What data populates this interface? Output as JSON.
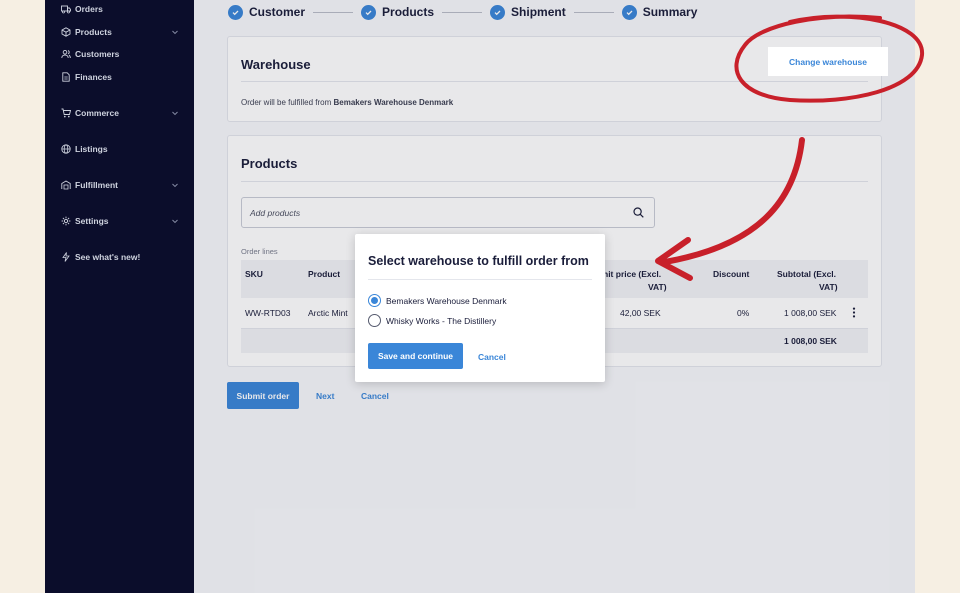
{
  "sidebar": {
    "items": [
      {
        "label": "Orders",
        "icon": "truck-icon",
        "has_chevron": false
      },
      {
        "label": "Products",
        "icon": "box-icon",
        "has_chevron": true
      },
      {
        "label": "Customers",
        "icon": "users-icon",
        "has_chevron": false
      },
      {
        "label": "Finances",
        "icon": "document-icon",
        "has_chevron": false
      },
      {
        "label": "Commerce",
        "icon": "cart-icon",
        "has_chevron": true
      },
      {
        "label": "Listings",
        "icon": "globe-icon",
        "has_chevron": false
      },
      {
        "label": "Fulfillment",
        "icon": "warehouse-icon",
        "has_chevron": true
      },
      {
        "label": "Settings",
        "icon": "gear-icon",
        "has_chevron": true
      },
      {
        "label": "See what's new!",
        "icon": "sparkle-icon",
        "has_chevron": false
      }
    ]
  },
  "stepper": {
    "steps": [
      "Customer",
      "Products",
      "Shipment",
      "Summary"
    ]
  },
  "warehouse": {
    "title": "Warehouse",
    "change_button": "Change warehouse",
    "fulfilled_prefix": "Order will be fulfilled from",
    "fulfilled_name": "Bemakers Warehouse Denmark"
  },
  "products": {
    "title": "Products",
    "search_placeholder": "Add products",
    "order_lines_label": "Order lines",
    "columns": {
      "sku": "SKU",
      "product": "Product",
      "unit_price_1": "nit price (Excl.",
      "unit_price_2": "VAT)",
      "discount": "Discount",
      "subtotal_1": "Subtotal (Excl.",
      "subtotal_2": "VAT)"
    },
    "row": {
      "sku": "WW-RTD03",
      "product": "Arctic Mint",
      "unit_price": "42,00 SEK",
      "discount": "0%",
      "subtotal": "1 008,00 SEK"
    },
    "total": "1 008,00 SEK"
  },
  "actions": {
    "submit": "Submit order",
    "next": "Next",
    "cancel": "Cancel"
  },
  "modal": {
    "title": "Select warehouse to fulfill order from",
    "options": [
      "Bemakers Warehouse Denmark",
      "Whisky Works - The Distillery"
    ],
    "selected_index": 0,
    "save": "Save and continue",
    "cancel": "Cancel"
  },
  "colors": {
    "accent": "#3a86d8",
    "sidebar": "#0b0d2b",
    "annotation": "#c8202a",
    "background": "#f6efe3"
  }
}
